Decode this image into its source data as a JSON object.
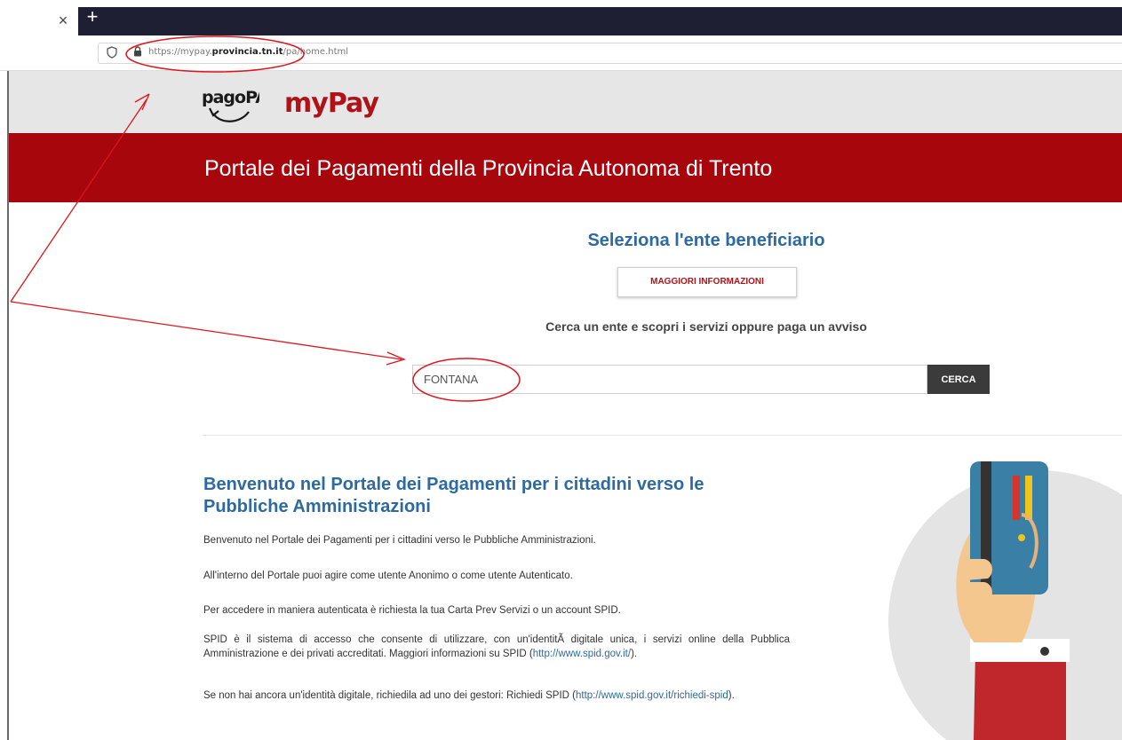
{
  "browser": {
    "close_tab_glyph": "×",
    "new_tab_glyph": "+",
    "url_prefix": "https://mypay.",
    "url_domain": "provincia.tn.it",
    "url_path": "/pa/home.html",
    "icons": [
      "shield-icon",
      "lock-icon"
    ]
  },
  "header": {
    "logo_pagopa": "pagoPA",
    "logo_mypay": "myPay",
    "banner_title": "Portale dei Pagamenti della Provincia Autonoma di Trento",
    "banner_color": "#a6060c"
  },
  "search": {
    "title": "Seleziona l'ente beneficiario",
    "info_button": "MAGGIORI INFORMAZIONI",
    "hint": "Cerca un ente e scopri i servizi oppure paga un avviso",
    "input_value": "FONTANA",
    "button": "CERCA"
  },
  "welcome": {
    "title": "Benvenuto nel Portale dei Pagamenti per i cittadini verso le Pubbliche Amministrazioni",
    "p1": "Benvenuto nel Portale dei Pagamenti per i cittadini verso le Pubbliche Amministrazioni.",
    "p2": "All'interno del Portale puoi agire come utente Anonimo o come utente Autenticato.",
    "p3": "Per accedere in maniera autenticata è richiesta la tua Carta Prev Servizi o un account SPID.",
    "p4_text": "SPID è il sistema di accesso che consente di utilizzare, con un'identitÃ  digitale unica, i servizi online della Pubblica Amministrazione e dei privati accreditati. Maggiori informazioni su SPID (",
    "p4_link": "http://www.spid.gov.it/",
    "p4_end": ").",
    "p5_text": "Se non hai ancora un'identità digitale, richiedila ad uno dei gestori: Richiedi SPID (",
    "p5_link": "http://www.spid.gov.it/richiedi-spid",
    "p5_end": ")."
  },
  "colors": {
    "accent_blue": "#2c6aa0",
    "annotation_red": "#e0141c"
  }
}
